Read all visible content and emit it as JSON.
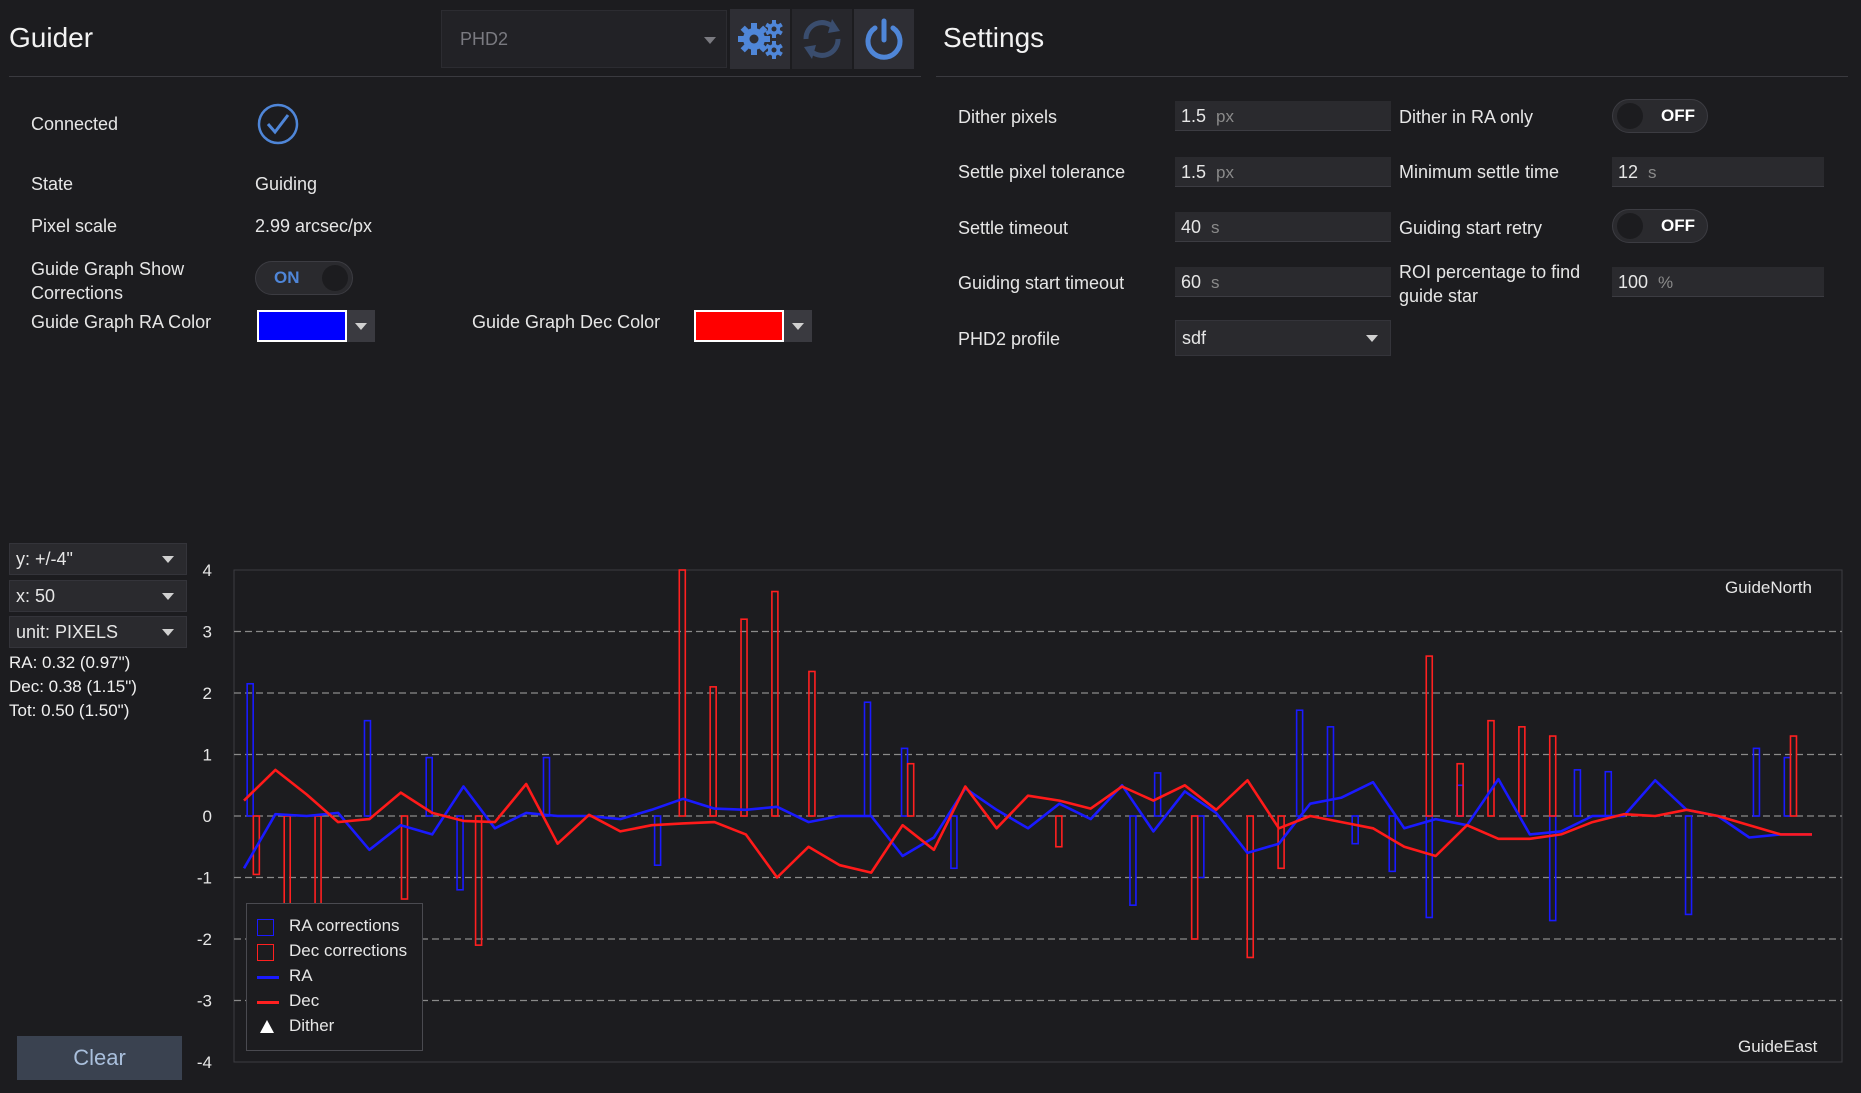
{
  "guider": {
    "title": "Guider",
    "device_select": "PHD2",
    "connected_label": "Connected",
    "state_label": "State",
    "state_value": "Guiding",
    "pixel_scale_label": "Pixel scale",
    "pixel_scale_value": "2.99 arcsec/px",
    "show_corrections_label_1": "Guide Graph Show",
    "show_corrections_label_2": "Corrections",
    "show_corrections_toggle": "ON",
    "ra_color_label": "Guide Graph RA Color",
    "dec_color_label": "Guide Graph Dec Color",
    "ra_color": "#0000ff",
    "dec_color": "#ff0000"
  },
  "settings": {
    "title": "Settings",
    "dither_pixels_label": "Dither pixels",
    "dither_pixels_value": "1.5",
    "dither_pixels_unit": "px",
    "settle_tol_label": "Settle pixel tolerance",
    "settle_tol_value": "1.5",
    "settle_tol_unit": "px",
    "settle_timeout_label": "Settle timeout",
    "settle_timeout_value": "40",
    "settle_timeout_unit": "s",
    "start_timeout_label": "Guiding start timeout",
    "start_timeout_value": "60",
    "start_timeout_unit": "s",
    "profile_label": "PHD2 profile",
    "profile_value": "sdf",
    "dither_ra_label": "Dither in RA only",
    "dither_ra_toggle": "OFF",
    "min_settle_label": "Minimum settle time",
    "min_settle_value": "12",
    "min_settle_unit": "s",
    "start_retry_label": "Guiding start retry",
    "start_retry_toggle": "OFF",
    "roi_label_1": "ROI percentage to find",
    "roi_label_2": "guide star",
    "roi_value": "100",
    "roi_unit": "%"
  },
  "graph_controls": {
    "y_scale": "y: +/-4\"",
    "x_scale": "x: 50",
    "unit": "unit: PIXELS",
    "ra_stat": "RA: 0.32 (0.97\")",
    "dec_stat": "Dec: 0.38 (1.15\")",
    "tot_stat": "Tot: 0.50 (1.50\")",
    "clear_label": "Clear"
  },
  "chart_data": {
    "type": "line",
    "ylim": [
      -4,
      4
    ],
    "yticks": [
      "4",
      "3",
      "2",
      "1",
      "0",
      "-1",
      "-2",
      "-3",
      "-4"
    ],
    "annotations": [
      "GuideNorth",
      "GuideEast"
    ],
    "legend": [
      "RA corrections",
      "Dec corrections",
      "RA",
      "Dec",
      "Dither"
    ],
    "x": [
      1,
      2,
      3,
      4,
      5,
      6,
      7,
      8,
      9,
      10,
      11,
      12,
      13,
      14,
      15,
      16,
      17,
      18,
      19,
      20,
      21,
      22,
      23,
      24,
      25,
      26,
      27,
      28,
      29,
      30,
      31,
      32,
      33,
      34,
      35,
      36,
      37,
      38,
      39,
      40,
      41,
      42,
      43,
      44,
      45,
      46,
      47,
      48,
      49,
      50,
      51
    ],
    "series": [
      {
        "name": "RA",
        "color": "#0000ff",
        "values": [
          -0.85,
          0.03,
          0.0,
          0.05,
          -0.55,
          -0.15,
          -0.3,
          0.48,
          -0.2,
          0.05,
          0.0,
          0.0,
          -0.05,
          0.1,
          0.28,
          0.12,
          0.1,
          0.15,
          -0.1,
          0.0,
          0.0,
          -0.65,
          -0.35,
          0.45,
          0.1,
          -0.2,
          0.2,
          -0.05,
          0.5,
          -0.25,
          0.4,
          0.05,
          -0.6,
          -0.45,
          0.2,
          0.3,
          0.55,
          -0.2,
          -0.05,
          -0.15,
          0.6,
          -0.3,
          -0.25,
          0.0,
          0.0,
          0.58,
          0.1,
          0.0,
          -0.35,
          -0.3,
          -0.3
        ]
      },
      {
        "name": "Dec",
        "color": "#ff0000",
        "values": [
          0.25,
          0.75,
          0.35,
          -0.1,
          -0.05,
          0.38,
          0.05,
          -0.08,
          -0.1,
          0.52,
          -0.45,
          0.02,
          -0.25,
          -0.15,
          -0.12,
          -0.1,
          -0.3,
          -1.0,
          -0.5,
          -0.8,
          -0.92,
          -0.15,
          -0.55,
          0.48,
          -0.2,
          0.33,
          0.25,
          0.12,
          0.48,
          0.25,
          0.5,
          0.1,
          0.58,
          -0.2,
          0.0,
          -0.1,
          -0.2,
          -0.5,
          -0.65,
          -0.15,
          -0.37,
          -0.37,
          -0.3,
          -0.1,
          0.03,
          0.0,
          0.1,
          0.0,
          -0.15,
          -0.3,
          -0.3
        ]
      }
    ],
    "ra_corrections": [
      [
        0.5,
        2.15
      ],
      [
        10,
        1.55
      ],
      [
        15,
        0.95
      ],
      [
        17.5,
        -1.2
      ],
      [
        24.5,
        0.95
      ],
      [
        33.5,
        -0.8
      ],
      [
        50.5,
        1.85
      ],
      [
        53.5,
        1.1
      ],
      [
        57.5,
        -0.85
      ],
      [
        72,
        -1.45
      ],
      [
        74,
        0.7
      ],
      [
        77.5,
        -1.0
      ],
      [
        85.5,
        1.72
      ],
      [
        88,
        1.45
      ],
      [
        90,
        -0.45
      ],
      [
        93,
        -0.9
      ],
      [
        96,
        -1.65
      ],
      [
        98.5,
        0.5
      ],
      [
        106,
        -1.7
      ],
      [
        108,
        0.75
      ],
      [
        110.5,
        0.72
      ],
      [
        117,
        -1.6
      ],
      [
        122.5,
        1.1
      ],
      [
        125,
        0.95
      ]
    ],
    "dec_corrections": [
      [
        1,
        -0.95
      ],
      [
        3.5,
        -1.5
      ],
      [
        6,
        -1.45
      ],
      [
        13,
        -1.35
      ],
      [
        19,
        -2.1
      ],
      [
        35.5,
        4.0
      ],
      [
        38,
        2.1
      ],
      [
        40.5,
        3.2
      ],
      [
        43,
        3.65
      ],
      [
        46,
        2.35
      ],
      [
        54,
        0.85
      ],
      [
        66,
        -0.5
      ],
      [
        77,
        -2.0
      ],
      [
        81.5,
        -2.3
      ],
      [
        84,
        -0.85
      ],
      [
        96,
        2.6
      ],
      [
        98.5,
        0.85
      ],
      [
        101,
        1.55
      ],
      [
        103.5,
        1.45
      ],
      [
        106,
        1.3
      ],
      [
        125.5,
        1.3
      ]
    ]
  }
}
